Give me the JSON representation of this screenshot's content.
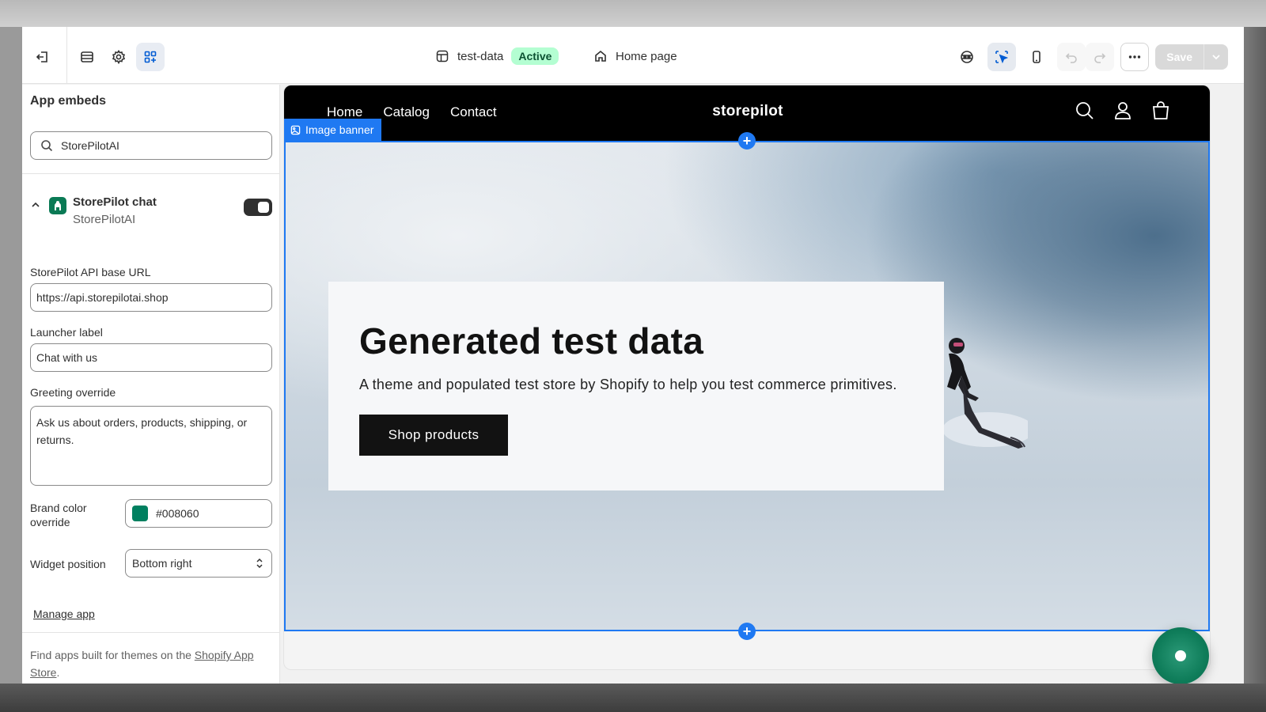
{
  "toolbar": {
    "theme_name": "test-data",
    "theme_status": "Active",
    "page_name": "Home page",
    "save_label": "Save"
  },
  "sidebar": {
    "title": "App embeds",
    "search_value": "StorePilotAI",
    "embed": {
      "name": "StorePilot chat",
      "provider": "StorePilotAI",
      "enabled": true
    },
    "fields": {
      "api_label": "StorePilot API base URL",
      "api_value": "https://api.storepilotai.shop",
      "launcher_label": "Launcher label",
      "launcher_value": "Chat with us",
      "greeting_label": "Greeting override",
      "greeting_value": "Ask us about orders, products, shipping, or returns.",
      "brand_color_label": "Brand color override",
      "brand_color_value": "#008060",
      "position_label": "Widget position",
      "position_value": "Bottom right"
    },
    "manage_link": "Manage app",
    "footer_prefix": "Find apps built for themes on the ",
    "footer_link": "Shopify App Store",
    "footer_suffix": "."
  },
  "store": {
    "nav": [
      "Home",
      "Catalog",
      "Contact"
    ],
    "logo": "storepilot",
    "section_tag": "Image banner",
    "hero_title": "Generated test data",
    "hero_subtitle": "A theme and populated test store by Shopify to help you test commerce primitives.",
    "hero_button": "Shop products"
  },
  "colors": {
    "accent": "#1f79f2",
    "brand": "#008060",
    "active_badge_bg": "#b4fed2"
  }
}
